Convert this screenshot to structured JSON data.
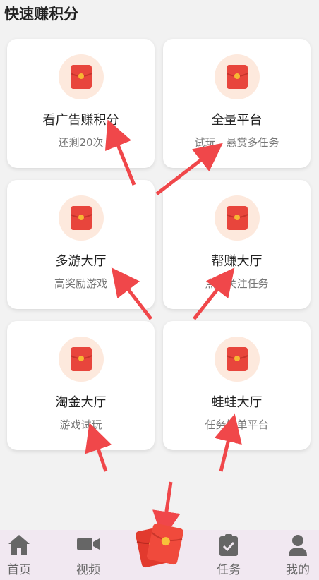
{
  "section": {
    "title": "快速赚积分"
  },
  "cards": [
    {
      "title": "看广告赚积分",
      "subtitle": "还剩20次"
    },
    {
      "title": "全量平台",
      "subtitle": "试玩、悬赏多任务"
    },
    {
      "title": "多游大厅",
      "subtitle": "高奖励游戏"
    },
    {
      "title": "帮赚大厅",
      "subtitle": "点赞关注任务"
    },
    {
      "title": "淘金大厅",
      "subtitle": "游戏试玩"
    },
    {
      "title": "蛙蛙大厅",
      "subtitle": "任务接单平台"
    }
  ],
  "tabbar": {
    "items": [
      {
        "label": "首页",
        "icon": "home-icon"
      },
      {
        "label": "视频",
        "icon": "video-icon"
      },
      {
        "label": "",
        "icon": "red-packet-icon"
      },
      {
        "label": "任务",
        "icon": "task-clipboard-icon"
      },
      {
        "label": "我的",
        "icon": "user-icon"
      }
    ]
  },
  "colors": {
    "accent_red": "#e8453c",
    "icon_bg": "#fde9dd",
    "arrow": "#f0474a",
    "tabbar_bg": "#f1e8f1"
  }
}
